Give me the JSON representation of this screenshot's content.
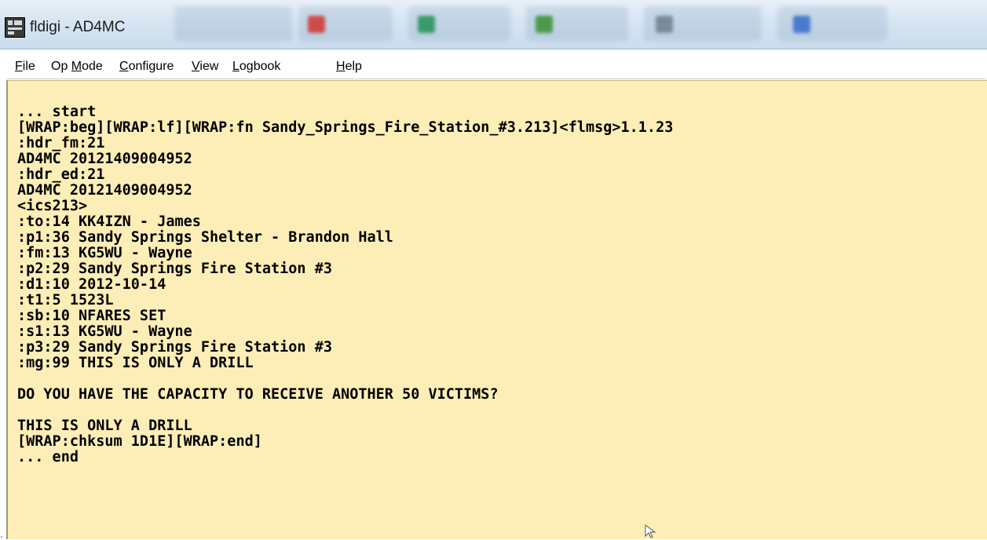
{
  "window": {
    "title": "fldigi - AD4MC",
    "icon": "fldigi-app-icon"
  },
  "menu": {
    "items": [
      {
        "id": "file",
        "accel": "F",
        "rest": "ile"
      },
      {
        "id": "op-mode",
        "pre": "Op ",
        "accel": "M",
        "rest": "ode"
      },
      {
        "id": "configure",
        "accel": "C",
        "rest": "onfigure"
      },
      {
        "id": "view",
        "accel": "V",
        "rest": "iew"
      },
      {
        "id": "logbook",
        "accel": "L",
        "rest": "ogbook"
      },
      {
        "id": "help",
        "accel": "H",
        "rest": "elp"
      }
    ]
  },
  "rx": {
    "lines": [
      "... start",
      "[WRAP:beg][WRAP:lf][WRAP:fn Sandy_Springs_Fire_Station_#3.213]<flmsg>1.1.23",
      ":hdr_fm:21",
      "AD4MC 20121409004952",
      ":hdr_ed:21",
      "AD4MC 20121409004952",
      "<ics213>",
      ":to:14 KK4IZN - James",
      ":p1:36 Sandy Springs Shelter - Brandon Hall",
      ":fm:13 KG5WU - Wayne",
      ":p2:29 Sandy Springs Fire Station #3",
      ":d1:10 2012-10-14",
      ":t1:5 1523L",
      ":sb:10 NFARES SET",
      ":s1:13 KG5WU - Wayne",
      ":p3:29 Sandy Springs Fire Station #3",
      ":mg:99 THIS IS ONLY A DRILL",
      "",
      "DO YOU HAVE THE CAPACITY TO RECEIVE ANOTHER 50 VICTIMS?",
      "",
      "THIS IS ONLY A DRILL",
      "[WRAP:chksum 1D1E][WRAP:end]",
      "... end"
    ]
  }
}
